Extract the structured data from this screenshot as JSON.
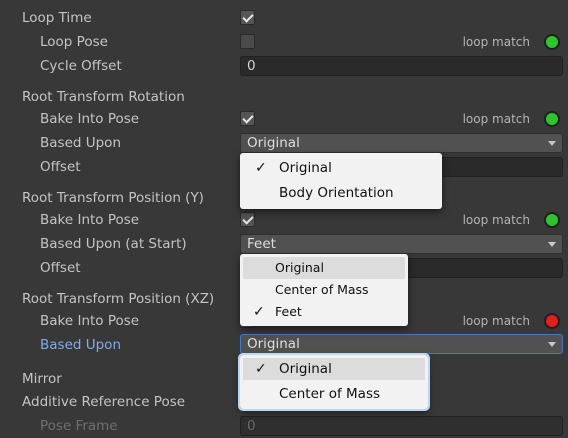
{
  "loop_time": {
    "label": "Loop Time",
    "checked": true
  },
  "loop_pose": {
    "label": "Loop Pose",
    "checked": false,
    "match_label": "loop match",
    "match_color": "#2ec42e"
  },
  "cycle_offset": {
    "label": "Cycle Offset",
    "value": "0"
  },
  "rotation": {
    "header": "Root Transform Rotation",
    "bake_label": "Bake Into Pose",
    "bake_checked": true,
    "match_label": "loop match",
    "match_color": "#2ec42e",
    "based_label": "Based Upon",
    "based_value": "Original",
    "offset_label": "Offset",
    "menu": [
      {
        "label": "Original",
        "checked": true
      },
      {
        "label": "Body Orientation",
        "checked": false
      }
    ]
  },
  "position_y": {
    "header": "Root Transform Position (Y)",
    "bake_label": "Bake Into Pose",
    "bake_checked": true,
    "match_label": "loop match",
    "match_color": "#2ec42e",
    "based_label": "Based Upon (at Start)",
    "based_value": "Feet",
    "offset_label": "Offset",
    "menu": [
      {
        "label": "Original",
        "checked": false,
        "highlighted": true
      },
      {
        "label": "Center of Mass",
        "checked": false
      },
      {
        "label": "Feet",
        "checked": true
      }
    ]
  },
  "position_xz": {
    "header": "Root Transform Position (XZ)",
    "bake_label": "Bake Into Pose",
    "bake_checked": true,
    "match_label": "loop match",
    "match_color": "#e01e1e",
    "based_label": "Based Upon",
    "based_value": "Original",
    "menu": [
      {
        "label": "Original",
        "checked": true,
        "highlighted": true
      },
      {
        "label": "Center of Mass",
        "checked": false
      }
    ]
  },
  "mirror": {
    "label": "Mirror"
  },
  "additive": {
    "label": "Additive Reference Pose",
    "pose_frame_label": "Pose Frame",
    "pose_frame_value": "0"
  }
}
